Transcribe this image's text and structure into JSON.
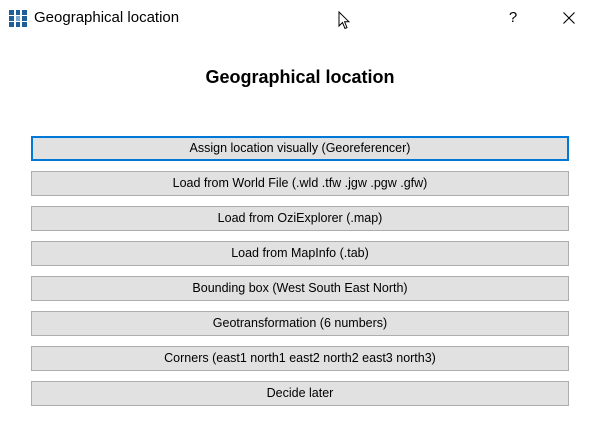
{
  "window": {
    "title": "Geographical location",
    "help_label": "?",
    "icons": {
      "app": "map-grid-icon",
      "close": "close-icon",
      "cursor": "mouse-pointer-icon"
    }
  },
  "heading": "Geographical location",
  "buttons": [
    {
      "label": "Assign location visually (Georeferencer)",
      "focused": true
    },
    {
      "label": "Load from World File (.wld .tfw .jgw .pgw .gfw)"
    },
    {
      "label": "Load from OziExplorer (.map)"
    },
    {
      "label": "Load from MapInfo (.tab)"
    },
    {
      "label": "Bounding box (West South East North)"
    },
    {
      "label": "Geotransformation (6 numbers)"
    },
    {
      "label": "Corners (east1 north1 east2 north2 east3 north3)"
    },
    {
      "label": "Decide later"
    }
  ],
  "colors": {
    "button_bg": "#e1e1e1",
    "button_border": "#adadad",
    "focus_border": "#0078d7",
    "icon_blue": "#1f5f99"
  }
}
